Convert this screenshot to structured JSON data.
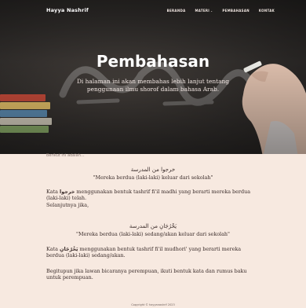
{
  "nav": {
    "brand": "Hayya Nashrif",
    "items": [
      "BERANDA",
      "MATERI",
      "PEMBAHASAN",
      "KONTAK"
    ],
    "dropdown_caret": "⌄"
  },
  "hero": {
    "title": "Pembahasan",
    "subtitle": "Di halaman ini akan membahas lebih lanjut tentang penggunaan ilmu shorof dalam bahasa Arab."
  },
  "content": {
    "crumb": "Berikut ini adalah...",
    "example1": {
      "arabic": "خرجوا من المدرسة",
      "translation": "\"Mereka berdua (laki-laki) keluar dari sekolah\""
    },
    "para1_prefix": "Kata ",
    "para1_word": "خرجوا",
    "para1_suffix": " menggunakan bentuk tashrif fi'il madhi yang berarti mereka berdua (laki-laki) telah.",
    "para1_line2": "Selanjutnya jika,",
    "example2": {
      "arabic": "يَخْرُجَانِ من المدرسة",
      "translation": "\"Mereka berdua (laki-laki) sedang/akan keluar dari sekolah\""
    },
    "para2_prefix": "Kata ",
    "para2_word": "يَخْرُجَانِ",
    "para2_suffix": " menggunakan bentuk tashrif fi'il mudhori' yang berarti mereka berdua (laki-laki) sedang/akan.",
    "para3": "Begitupun jika lawan bicaranya perempuan, ikuti bentuk kata dan rumus baku untuk perempuan."
  },
  "footer": {
    "copyright": "Copyright © hayyanashrif 2023"
  }
}
